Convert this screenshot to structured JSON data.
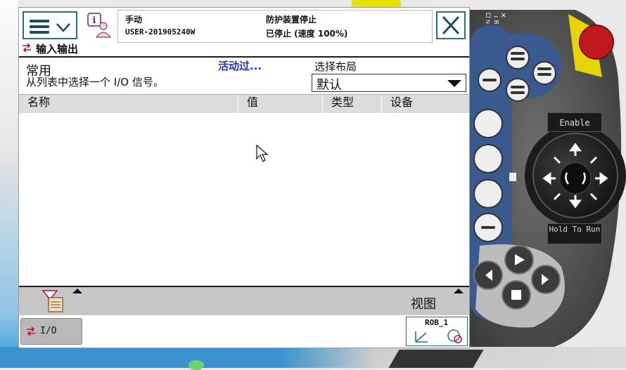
{
  "status": {
    "mode": "手动",
    "system": "USER-201905240W",
    "safety": "防护装置停止",
    "motion": "已停止 (速度 100%)"
  },
  "app": {
    "title": "输入输出"
  },
  "section": {
    "title": "常用",
    "description": "从列表中选择一个 I/O 信号。",
    "active_filter": "活动过...",
    "layout_label": "选择布局",
    "layout_value": "默认"
  },
  "table": {
    "columns": [
      "名称",
      "值",
      "类型",
      "设备"
    ],
    "rows": []
  },
  "view_bar": {
    "view_label": "视图"
  },
  "taskbar": {
    "io_label": "I/O",
    "robot_label": "ROB_1"
  },
  "pendant": {
    "enable_label": "Enable",
    "hold_to_run_label": "Hold To Run"
  },
  "colors": {
    "accent": "#2a6f7f",
    "link": "#1b2fc0",
    "bar": "#c7c7c7"
  }
}
